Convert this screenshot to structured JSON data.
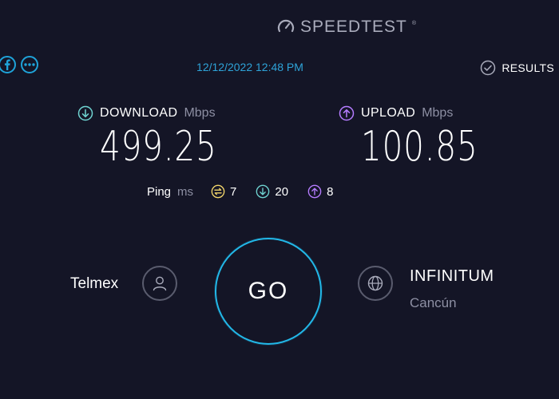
{
  "brand": {
    "name": "SPEEDTEST",
    "trademark": "®",
    "icon": "gauge-icon"
  },
  "top_bar": {
    "facebook_icon": "facebook-icon",
    "more_icon": "more-dots-icon",
    "timestamp": "12/12/2022 12:48 PM",
    "results_label": "RESULTS",
    "results_icon": "check-circle-icon"
  },
  "download": {
    "label": "DOWNLOAD",
    "unit": "Mbps",
    "value": "499.25",
    "icon": "arrow-down-circle-icon",
    "color": "#6fd3d1"
  },
  "upload": {
    "label": "UPLOAD",
    "unit": "Mbps",
    "value": "100.85",
    "icon": "arrow-up-circle-icon",
    "color": "#b57cff"
  },
  "ping": {
    "label": "Ping",
    "unit": "ms",
    "idle": {
      "value": "7",
      "color": "#f3d66b",
      "icon": "latency-icon"
    },
    "download": {
      "value": "20",
      "color": "#6fd3d1",
      "icon": "arrow-down-circle-icon"
    },
    "upload": {
      "value": "8",
      "color": "#b57cff",
      "icon": "arrow-up-circle-icon"
    }
  },
  "isp": {
    "name": "Telmex",
    "icon": "person-icon"
  },
  "go_button": {
    "label": "GO",
    "color": "#22b8e8"
  },
  "server": {
    "name": "INFINITUM",
    "location": "Cancún",
    "icon": "globe-icon"
  },
  "colors": {
    "background": "#141526",
    "accent": "#2ea3d8"
  }
}
